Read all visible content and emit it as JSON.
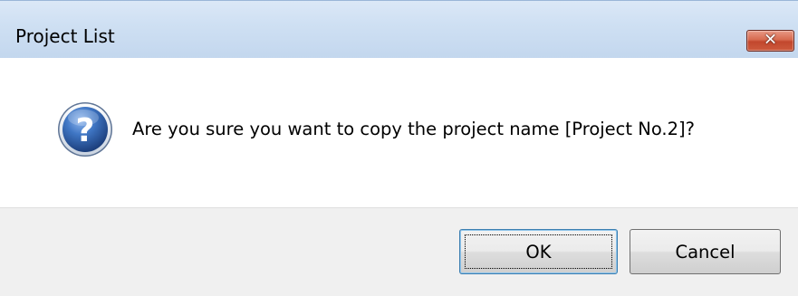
{
  "window": {
    "title": "Project List",
    "close_icon": "close-icon",
    "close_glyph": "✕",
    "close_color": "#c2472d"
  },
  "message": {
    "icon": "question-icon",
    "icon_color": "#2f5fa6",
    "text": "Are you sure you want to copy the project name [Project No.2]?"
  },
  "buttons": {
    "ok_label": "OK",
    "cancel_label": "Cancel"
  }
}
